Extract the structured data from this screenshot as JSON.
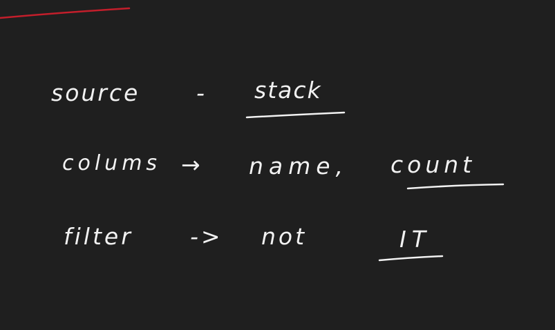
{
  "notes": {
    "line1": {
      "label": "source",
      "arrow": "-",
      "value": "stack"
    },
    "line2": {
      "label": "colums",
      "arrow": "→",
      "value1": "name,",
      "value2": "count"
    },
    "line3": {
      "label": "filter",
      "arrow": "->",
      "value1": "not",
      "value2": "IT"
    }
  },
  "colors": {
    "background": "#1f1f1f",
    "ink": "#f2f2f2",
    "accent": "#c41e2b"
  }
}
